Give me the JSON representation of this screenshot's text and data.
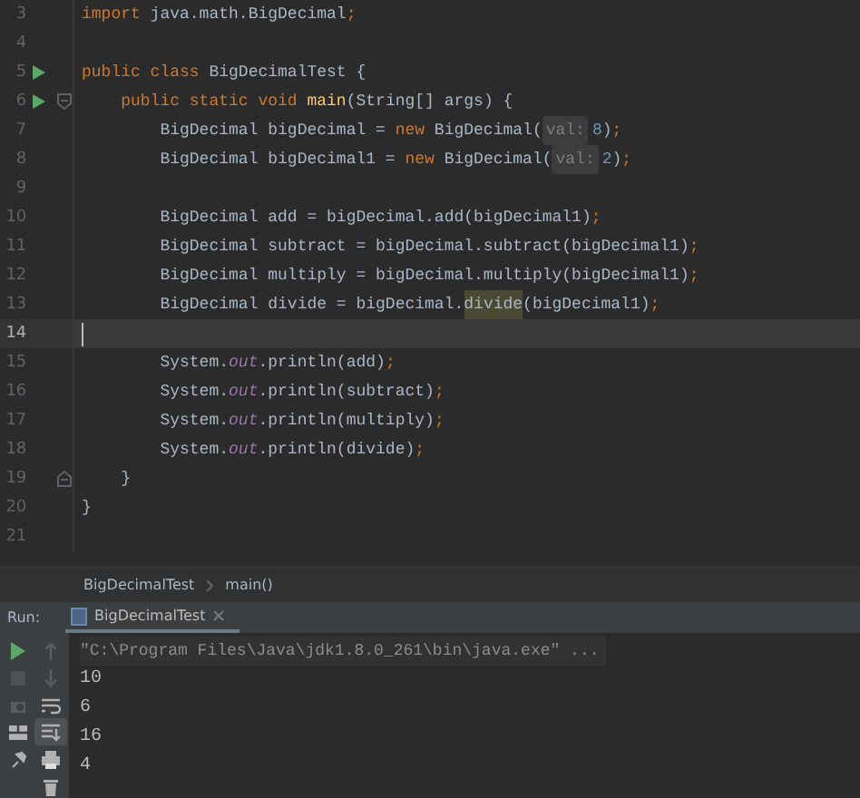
{
  "editor": {
    "lines": [
      {
        "number": "3",
        "runnable": false,
        "kind": "plain",
        "current": false,
        "tokens": [
          {
            "text": "import",
            "kind": "keyword"
          },
          {
            "text": " java.math.BigDecimal",
            "kind": "plain"
          },
          {
            "text": ";",
            "kind": "punct"
          }
        ]
      },
      {
        "number": "4",
        "runnable": false,
        "kind": "plain",
        "current": false
      },
      {
        "number": "5",
        "runnable": true,
        "kind": "plain",
        "current": false,
        "tokens": [
          {
            "text": "public class",
            "kind": "keyword"
          },
          {
            "text": " BigDecimalTest {",
            "kind": "plain"
          }
        ]
      },
      {
        "number": "6",
        "runnable": true,
        "kind": "fold_open",
        "current": false,
        "tokens": [
          {
            "text": "    public static void ",
            "kind": "keyword"
          },
          {
            "text": "main",
            "kind": "method"
          },
          {
            "text": "(String[] args) {",
            "kind": "plain"
          }
        ]
      },
      {
        "number": "7",
        "runnable": false,
        "kind": "plain",
        "current": false,
        "tokens": [
          {
            "text": "        BigDecimal bigDecimal = ",
            "kind": "plain"
          },
          {
            "text": "new",
            "kind": "keyword"
          },
          {
            "text": " BigDecimal(",
            "kind": "plain"
          },
          {
            "text": "val:",
            "kind": "hint"
          },
          {
            "text": "8",
            "kind": "number"
          },
          {
            "text": ")",
            "kind": "plain"
          },
          {
            "text": ";",
            "kind": "punct"
          }
        ]
      },
      {
        "number": "8",
        "runnable": false,
        "kind": "plain",
        "current": false,
        "tokens": [
          {
            "text": "        BigDecimal bigDecimal1 = ",
            "kind": "plain"
          },
          {
            "text": "new",
            "kind": "keyword"
          },
          {
            "text": " BigDecimal(",
            "kind": "plain"
          },
          {
            "text": "val:",
            "kind": "hint"
          },
          {
            "text": "2",
            "kind": "number"
          },
          {
            "text": ")",
            "kind": "plain"
          },
          {
            "text": ";",
            "kind": "punct"
          }
        ]
      },
      {
        "number": "9",
        "runnable": false,
        "kind": "plain",
        "current": false
      },
      {
        "number": "10",
        "runnable": false,
        "kind": "plain",
        "current": false,
        "tokens": [
          {
            "text": "        BigDecimal add = bigDecimal.add(bigDecimal1)",
            "kind": "plain"
          },
          {
            "text": ";",
            "kind": "punct"
          }
        ]
      },
      {
        "number": "11",
        "runnable": false,
        "kind": "plain",
        "current": false,
        "tokens": [
          {
            "text": "        BigDecimal subtract = bigDecimal.subtract(bigDecimal1)",
            "kind": "plain"
          },
          {
            "text": ";",
            "kind": "punct"
          }
        ]
      },
      {
        "number": "12",
        "runnable": false,
        "kind": "plain",
        "current": false,
        "tokens": [
          {
            "text": "        BigDecimal multiply = bigDecimal.multiply(bigDecimal1)",
            "kind": "plain"
          },
          {
            "text": ";",
            "kind": "punct"
          }
        ]
      },
      {
        "number": "13",
        "runnable": false,
        "kind": "plain",
        "current": false,
        "tokens": [
          {
            "text": "        BigDecimal divide = bigDecimal.",
            "kind": "plain"
          },
          {
            "text": "divide",
            "kind": "match"
          },
          {
            "text": "(bigDecimal1)",
            "kind": "plain"
          },
          {
            "text": ";",
            "kind": "punct"
          }
        ]
      },
      {
        "number": "14",
        "runnable": false,
        "kind": "plain",
        "current": true
      },
      {
        "number": "15",
        "runnable": false,
        "kind": "plain",
        "current": false,
        "tokens": [
          {
            "text": "        System.",
            "kind": "plain"
          },
          {
            "text": "out",
            "kind": "field"
          },
          {
            "text": ".println(add)",
            "kind": "plain"
          },
          {
            "text": ";",
            "kind": "punct"
          }
        ]
      },
      {
        "number": "16",
        "runnable": false,
        "kind": "plain",
        "current": false,
        "tokens": [
          {
            "text": "        System.",
            "kind": "plain"
          },
          {
            "text": "out",
            "kind": "field"
          },
          {
            "text": ".println(subtract)",
            "kind": "plain"
          },
          {
            "text": ";",
            "kind": "punct"
          }
        ]
      },
      {
        "number": "17",
        "runnable": false,
        "kind": "plain",
        "current": false,
        "tokens": [
          {
            "text": "        System.",
            "kind": "plain"
          },
          {
            "text": "out",
            "kind": "field"
          },
          {
            "text": ".println(multiply)",
            "kind": "plain"
          },
          {
            "text": ";",
            "kind": "punct"
          }
        ]
      },
      {
        "number": "18",
        "runnable": false,
        "kind": "plain",
        "current": false,
        "tokens": [
          {
            "text": "        System.",
            "kind": "plain"
          },
          {
            "text": "out",
            "kind": "field"
          },
          {
            "text": ".println(divide)",
            "kind": "plain"
          },
          {
            "text": ";",
            "kind": "punct"
          }
        ]
      },
      {
        "number": "19",
        "runnable": false,
        "kind": "fold_close",
        "current": false,
        "tokens": [
          {
            "text": "    }",
            "kind": "plain"
          }
        ]
      },
      {
        "number": "20",
        "runnable": false,
        "kind": "plain",
        "current": false,
        "tokens": [
          {
            "text": "}",
            "kind": "plain"
          }
        ]
      },
      {
        "number": "21",
        "runnable": false,
        "kind": "plain",
        "current": false
      }
    ]
  },
  "breadcrumbs": [
    "BigDecimalTest",
    "main()"
  ],
  "run_panel": {
    "label": "Run:",
    "tabs": [
      {
        "label": "BigDecimalTest",
        "selected": true
      }
    ],
    "scroll_to_end": true,
    "console": [
      {
        "text": "\"C:\\Program Files\\Java\\jdk1.8.0_261\\bin\\java.exe\" ...",
        "kind": "command"
      },
      {
        "text": "10",
        "kind": "output"
      },
      {
        "text": "6",
        "kind": "output"
      },
      {
        "text": "16",
        "kind": "output"
      },
      {
        "text": "4",
        "kind": "output"
      }
    ]
  }
}
